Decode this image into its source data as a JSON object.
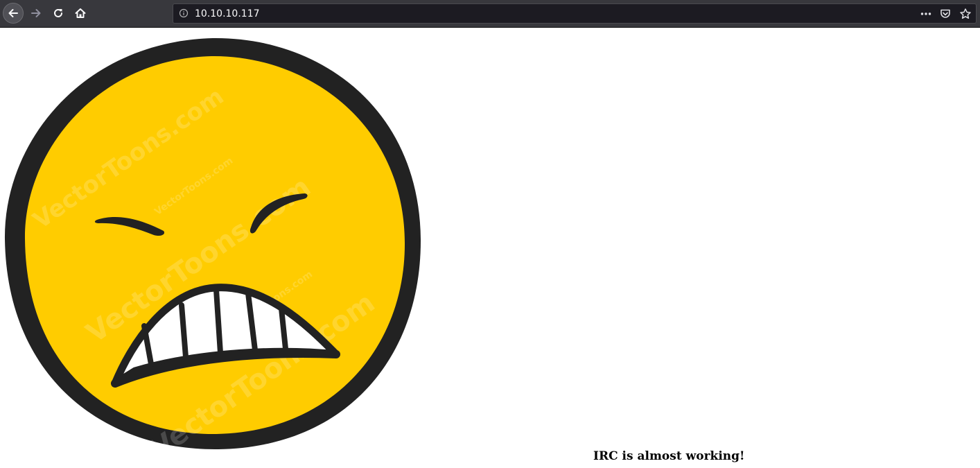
{
  "browser": {
    "url": "10.10.10.117",
    "icons": {
      "back": "back-arrow-icon",
      "forward": "forward-arrow-icon",
      "reload": "reload-icon",
      "home": "home-icon",
      "info": "info-icon",
      "more": "more-dots-icon",
      "pocket": "pocket-icon",
      "bookmark": "star-icon"
    }
  },
  "page": {
    "image": {
      "name": "grimacing-smiley-image",
      "watermark": "VectorToons.com"
    },
    "message": "IRC is almost working!"
  },
  "colors": {
    "toolbar": "#38383d",
    "urlbar": "#1c1b22",
    "face": "#ffcc00",
    "outline": "#222222"
  }
}
